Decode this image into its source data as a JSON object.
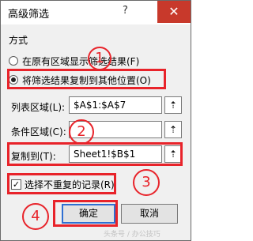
{
  "window": {
    "title": "高级筛选",
    "help_label": "?",
    "close_label": "✕"
  },
  "method": {
    "label": "方式",
    "options": [
      {
        "label": "在原有区域显示筛选结果(F)",
        "checked": false
      },
      {
        "label": "将筛选结果复制到其他位置(O)",
        "checked": true
      }
    ]
  },
  "fields": {
    "list_range": {
      "label": "列表区域(L):",
      "value": "$A$1:$A$7"
    },
    "criteria_range": {
      "label": "条件区域(C):",
      "value": ""
    },
    "copy_to": {
      "label": "复制到(T):",
      "value": "Sheet1!$B$1"
    }
  },
  "unique_records": {
    "label": "选择不重复的记录(R)",
    "checked": true
  },
  "buttons": {
    "ok": "确定",
    "cancel": "取消"
  },
  "annotations": {
    "step1": "1",
    "step2": "2",
    "step3": "3",
    "step4": "4",
    "color": "#e8232a"
  },
  "icons": {
    "collapse": "collapse-dialog-icon"
  },
  "watermark": "头条号 / 办公技巧"
}
